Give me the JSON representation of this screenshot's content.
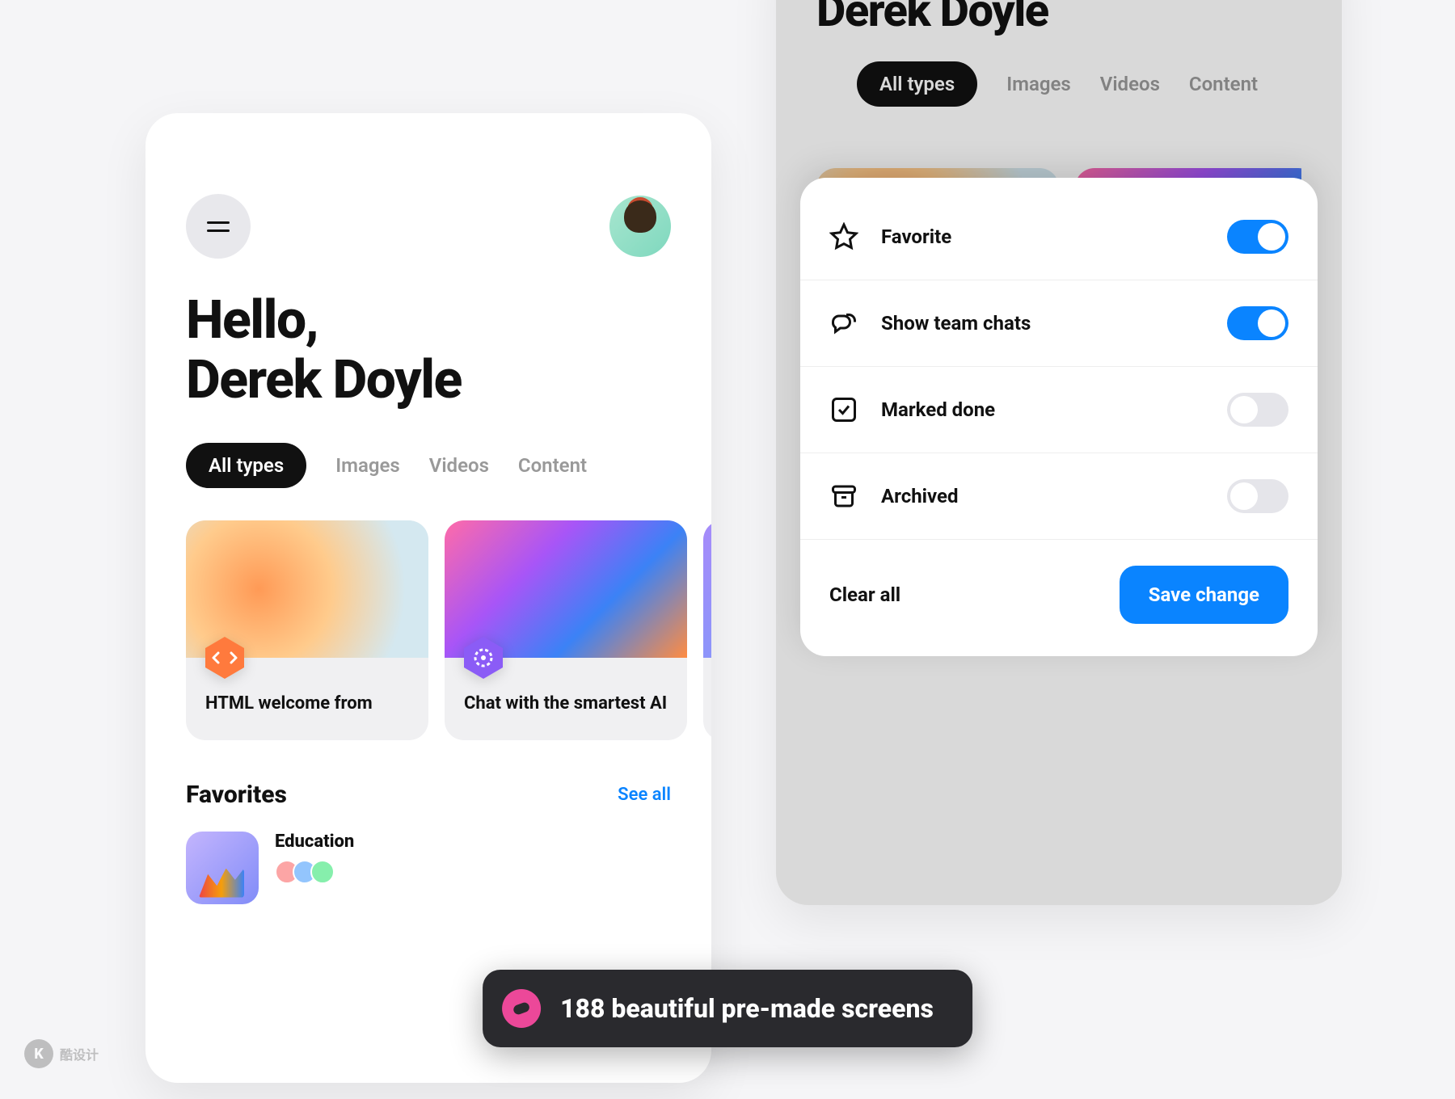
{
  "left": {
    "greeting_line1": "Hello,",
    "greeting_line2": "Derek Doyle",
    "tabs": [
      "All types",
      "Images",
      "Videos",
      "Content"
    ],
    "cards": [
      {
        "title": "HTML welcome from"
      },
      {
        "title": "Chat with the smartest AI"
      }
    ],
    "favorites": {
      "title": "Favorites",
      "see_all": "See all",
      "items": [
        {
          "title": "Education"
        }
      ]
    }
  },
  "right": {
    "name": "Derek Doyle",
    "tabs": [
      "All types",
      "Images",
      "Videos",
      "Content"
    ],
    "sheet": {
      "options": [
        {
          "label": "Favorite",
          "on": true,
          "icon": "star"
        },
        {
          "label": "Show team chats",
          "on": true,
          "icon": "chat"
        },
        {
          "label": "Marked done",
          "on": false,
          "icon": "check"
        },
        {
          "label": "Archived",
          "on": false,
          "icon": "archive"
        }
      ],
      "clear": "Clear all",
      "save": "Save change"
    }
  },
  "badge": {
    "text": "188 beautiful pre-made screens"
  },
  "watermark": {
    "text": "酷设计"
  }
}
